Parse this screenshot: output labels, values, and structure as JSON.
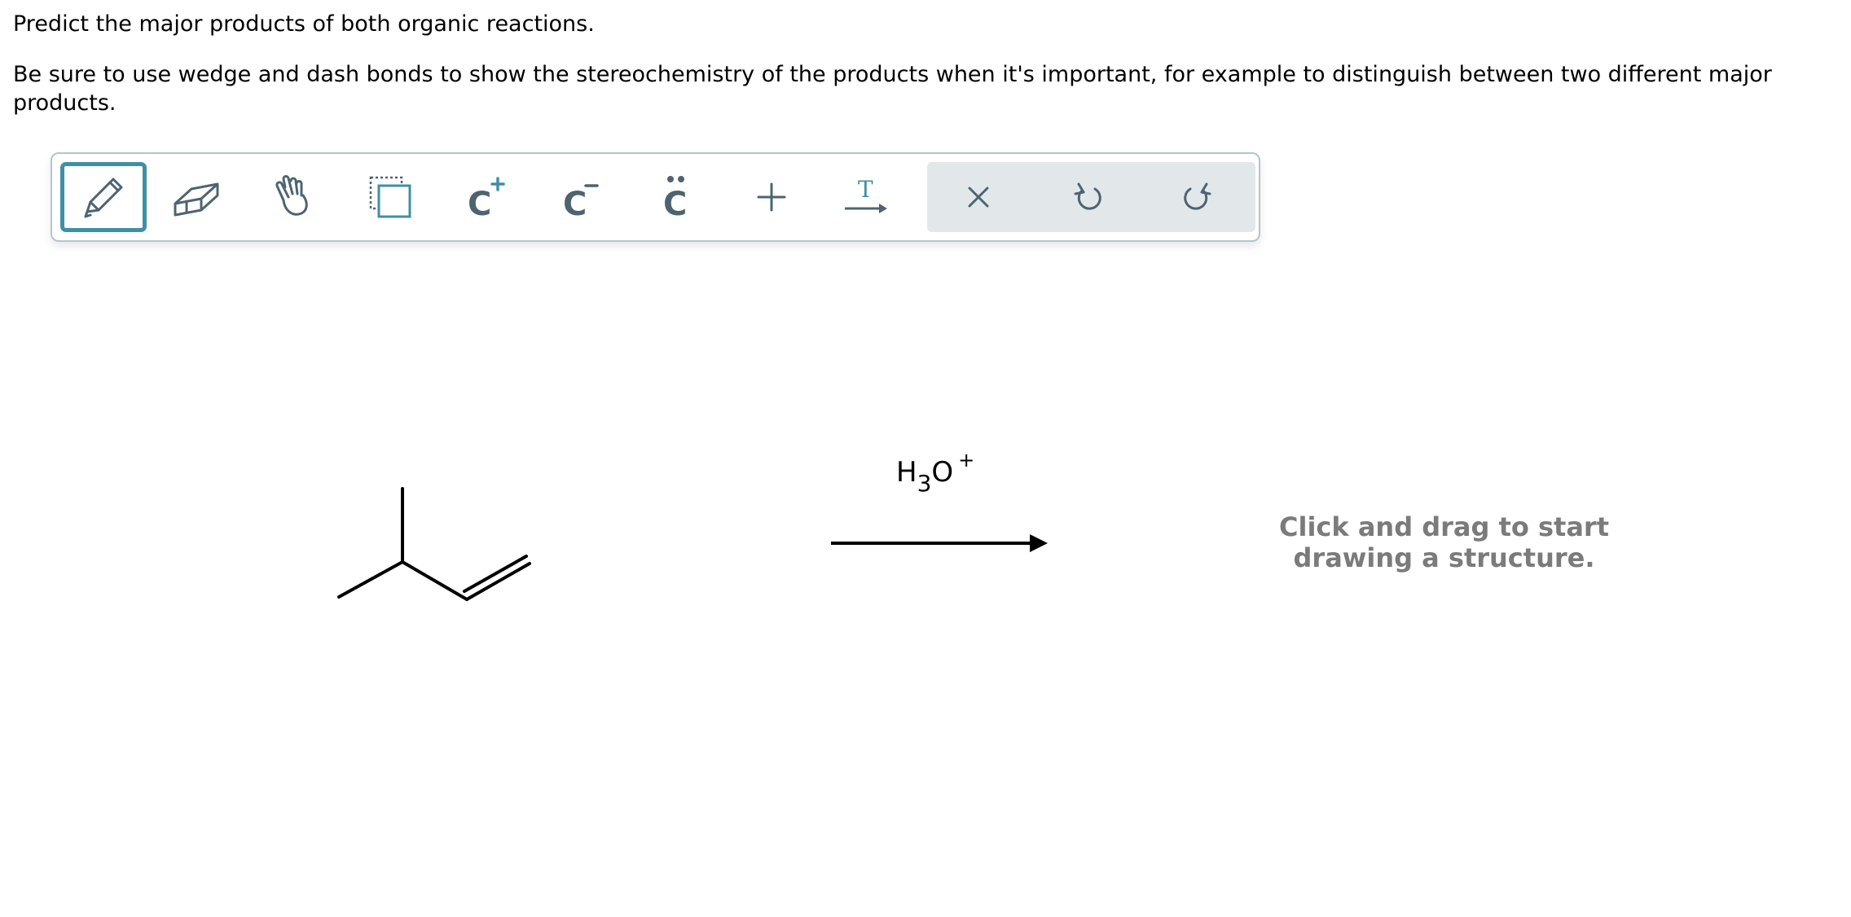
{
  "question": {
    "line1": "Predict the major products of both organic reactions.",
    "line2": "Be sure to use wedge and dash bonds to show the stereochemistry of the products when it's important, for example to distinguish between two different major products."
  },
  "toolbar": {
    "tools": [
      {
        "icon": "pencil-icon",
        "selected": true
      },
      {
        "icon": "eraser-icon"
      },
      {
        "icon": "hand-icon"
      },
      {
        "icon": "select-box-icon"
      },
      {
        "icon": "carbocation-icon",
        "label": "C",
        "charge": "+"
      },
      {
        "icon": "carbanion-icon",
        "label": "C",
        "charge": "−"
      },
      {
        "icon": "lone-pair-icon",
        "label": "C"
      },
      {
        "icon": "plus-icon"
      },
      {
        "icon": "text-arrow-icon",
        "label": "T"
      },
      {
        "icon": "clear-icon"
      },
      {
        "icon": "undo-icon"
      },
      {
        "icon": "redo-icon"
      }
    ],
    "accent_color": "#3f8fa6",
    "icon_color": "#4d6470",
    "group_bg": "#e2e7ea"
  },
  "reaction": {
    "reagent_main": "H",
    "reagent_sub": "3",
    "reagent_atom": "O",
    "reagent_charge": "+"
  },
  "product_area": {
    "placeholder_line1": "Click and drag to start",
    "placeholder_line2": "drawing a structure."
  }
}
